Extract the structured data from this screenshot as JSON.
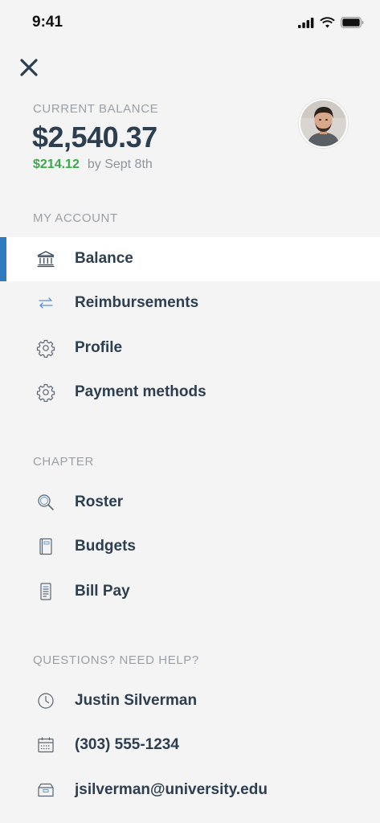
{
  "status_bar": {
    "time": "9:41"
  },
  "header": {
    "close_icon": "close-icon",
    "balance_label": "CURRENT BALANCE",
    "balance_amount": "$2,540.37",
    "balance_change": "$214.12",
    "balance_change_date": "by Sept 8th",
    "avatar": "avatar"
  },
  "my_account": {
    "title": "MY ACCOUNT",
    "items": [
      {
        "label": "Balance",
        "icon": "bank-icon",
        "active": true
      },
      {
        "label": "Reimbursements",
        "icon": "swap-arrows-icon",
        "active": false
      },
      {
        "label": "Profile",
        "icon": "gear-icon",
        "active": false
      },
      {
        "label": "Payment methods",
        "icon": "gear-icon",
        "active": false
      }
    ]
  },
  "chapter": {
    "title": "CHAPTER",
    "items": [
      {
        "label": "Roster",
        "icon": "search-icon"
      },
      {
        "label": "Budgets",
        "icon": "book-icon"
      },
      {
        "label": "Bill Pay",
        "icon": "receipt-icon"
      }
    ]
  },
  "help": {
    "title": "QUESTIONS? NEED HELP?",
    "items": [
      {
        "label": "Justin Silverman",
        "icon": "clock-icon"
      },
      {
        "label": "(303) 555-1234",
        "icon": "calendar-icon"
      },
      {
        "label": "jsilverman@university.edu",
        "icon": "inbox-icon"
      }
    ]
  },
  "colors": {
    "accent": "#2f7bbf",
    "positive": "#3aa84a",
    "text_primary": "#2c3e50",
    "text_muted": "#9aa0a6",
    "background": "#f4f4f4"
  }
}
